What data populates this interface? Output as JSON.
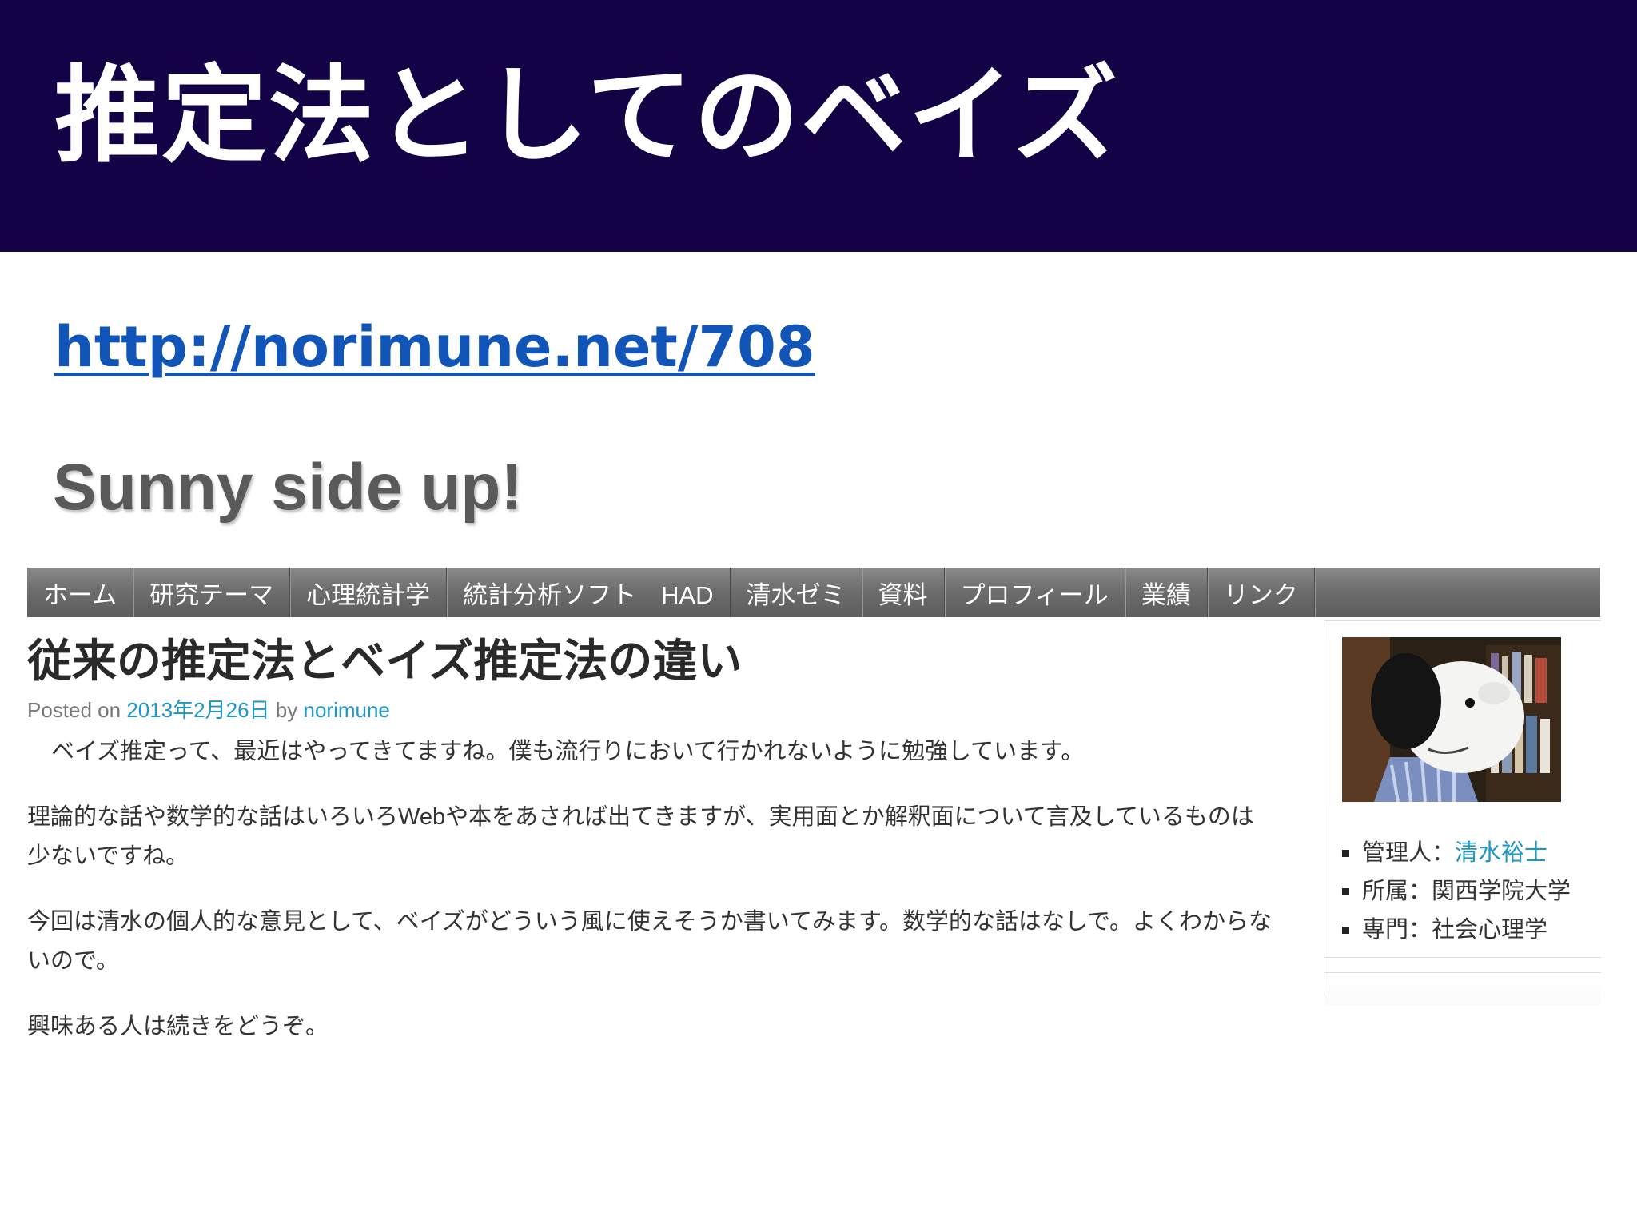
{
  "slide": {
    "title": "推定法としてのベイズ",
    "link": "http://norimune.net/708"
  },
  "site": {
    "title": "Sunny side up!"
  },
  "nav": [
    "ホーム",
    "研究テーマ",
    "心理統計学",
    "統計分析ソフト　HAD",
    "清水ゼミ",
    "資料",
    "プロフィール",
    "業績",
    "リンク"
  ],
  "post": {
    "title": "従来の推定法とベイズ推定法の違い",
    "posted_on": "Posted on",
    "date": "2013年2月26日",
    "by": "by",
    "author": "norimune",
    "paragraphs": [
      "ベイズ推定って、最近はやってきてますね。僕も流行りにおいて行かれないように勉強しています。",
      "理論的な話や数学的な話はいろいろWebや本をあされば出てきますが、実用面とか解釈面について言及しているものは少ないですね。",
      "今回は清水の個人的な意見として、ベイズがどういう風に使えそうか書いてみます。数学的な話はなしで。よくわからないので。",
      "興味ある人は続きをどうぞ。"
    ]
  },
  "sidebar": {
    "avatar_icon": "snoopy-avatar",
    "info": [
      {
        "label": "管理人：",
        "value": "清水裕士",
        "value_is_link": true
      },
      {
        "label": "所属：",
        "value": "関西学院大学",
        "value_is_link": false
      },
      {
        "label": "専門：",
        "value": "社会心理学",
        "value_is_link": false
      }
    ]
  },
  "colors": {
    "header_bg": "#140246",
    "link": "#1255b8",
    "blog_link": "#1d97c4",
    "nav_bg": "#6e6e6e"
  }
}
